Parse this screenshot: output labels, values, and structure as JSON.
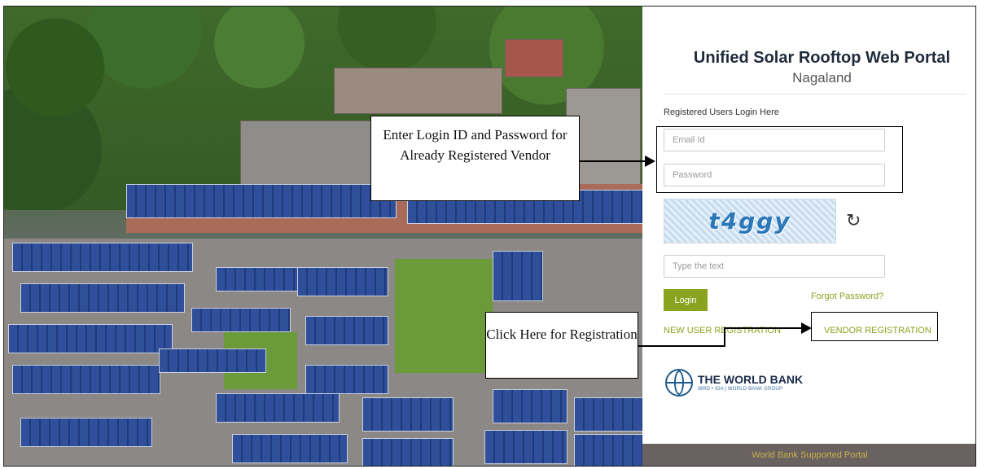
{
  "portal": {
    "title": "Unified Solar Rooftop Web Portal",
    "subtitle": "Nagaland",
    "login_heading": "Registered Users Login Here"
  },
  "form": {
    "email_placeholder": "Email Id",
    "password_placeholder": "Password",
    "captcha_text": "t4ggy",
    "captcha_input_placeholder": "Type the text",
    "login_label": "Login",
    "forgot_label": "Forgot Password?",
    "new_user_label": "NEW USER REGISTRATION",
    "vendor_label": "VENDOR REGISTRATION"
  },
  "sponsor": {
    "name": "THE WORLD BANK",
    "sub": "IBRD • IDA | WORLD BANK GROUP"
  },
  "footer": {
    "text": "World Bank Supported Portal"
  },
  "annotations": {
    "login_note": "Enter Login ID and Password for Already Registered Vendor",
    "register_note": "Click Here for Registration"
  },
  "colors": {
    "accent": "#8aa31f",
    "title": "#1e2a3a",
    "footer_bg": "#6a6260"
  },
  "icons": {
    "refresh": "refresh-icon",
    "globe": "world-bank-globe-icon"
  }
}
